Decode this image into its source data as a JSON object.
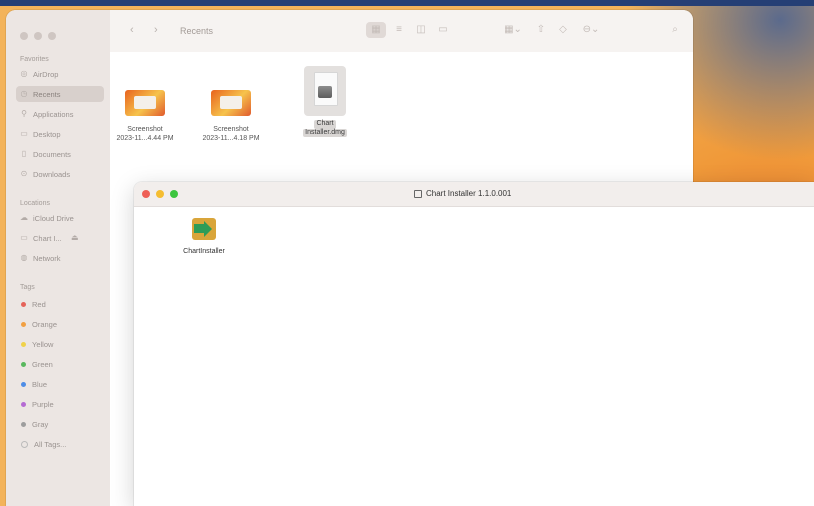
{
  "colors": {
    "accent": "#5b8dd9",
    "tag_red": "#e5635a",
    "tag_orange": "#f1a043",
    "tag_yellow": "#f0d24a",
    "tag_green": "#59b85e",
    "tag_blue": "#4e8de6",
    "tag_purple": "#b56bd3",
    "tag_gray": "#9d9d9d"
  },
  "finder": {
    "title": "Recents",
    "sidebar": {
      "favorites_header": "Favorites",
      "favorites": [
        {
          "label": "AirDrop",
          "icon": "airdrop-icon"
        },
        {
          "label": "Recents",
          "icon": "clock-icon",
          "selected": true
        },
        {
          "label": "Applications",
          "icon": "applications-icon"
        },
        {
          "label": "Desktop",
          "icon": "desktop-icon"
        },
        {
          "label": "Documents",
          "icon": "document-icon"
        },
        {
          "label": "Downloads",
          "icon": "download-icon"
        }
      ],
      "locations_header": "Locations",
      "locations": [
        {
          "label": "iCloud Drive",
          "icon": "cloud-icon"
        },
        {
          "label": "Chart I...",
          "icon": "disk-icon"
        },
        {
          "label": "Network",
          "icon": "globe-icon"
        }
      ],
      "tags_header": "Tags",
      "tags": [
        {
          "label": "Red",
          "color": "#e5635a"
        },
        {
          "label": "Orange",
          "color": "#f1a043"
        },
        {
          "label": "Yellow",
          "color": "#f0d24a"
        },
        {
          "label": "Green",
          "color": "#59b85e"
        },
        {
          "label": "Blue",
          "color": "#4e8de6"
        },
        {
          "label": "Purple",
          "color": "#b56bd3"
        },
        {
          "label": "Gray",
          "color": "#9d9d9d"
        },
        {
          "label": "All Tags...",
          "color": ""
        }
      ]
    },
    "files": [
      {
        "name_line1": "Screenshot",
        "name_line2": "2023-11...4.44 PM"
      },
      {
        "name_line1": "Screenshot",
        "name_line2": "2023-11...4.18 PM"
      },
      {
        "name_line1": "Chart",
        "name_line2": "Installer.dmg"
      }
    ]
  },
  "installer": {
    "title": "Chart Installer 1.1.0.001",
    "app_label": "ChartInstaller"
  }
}
